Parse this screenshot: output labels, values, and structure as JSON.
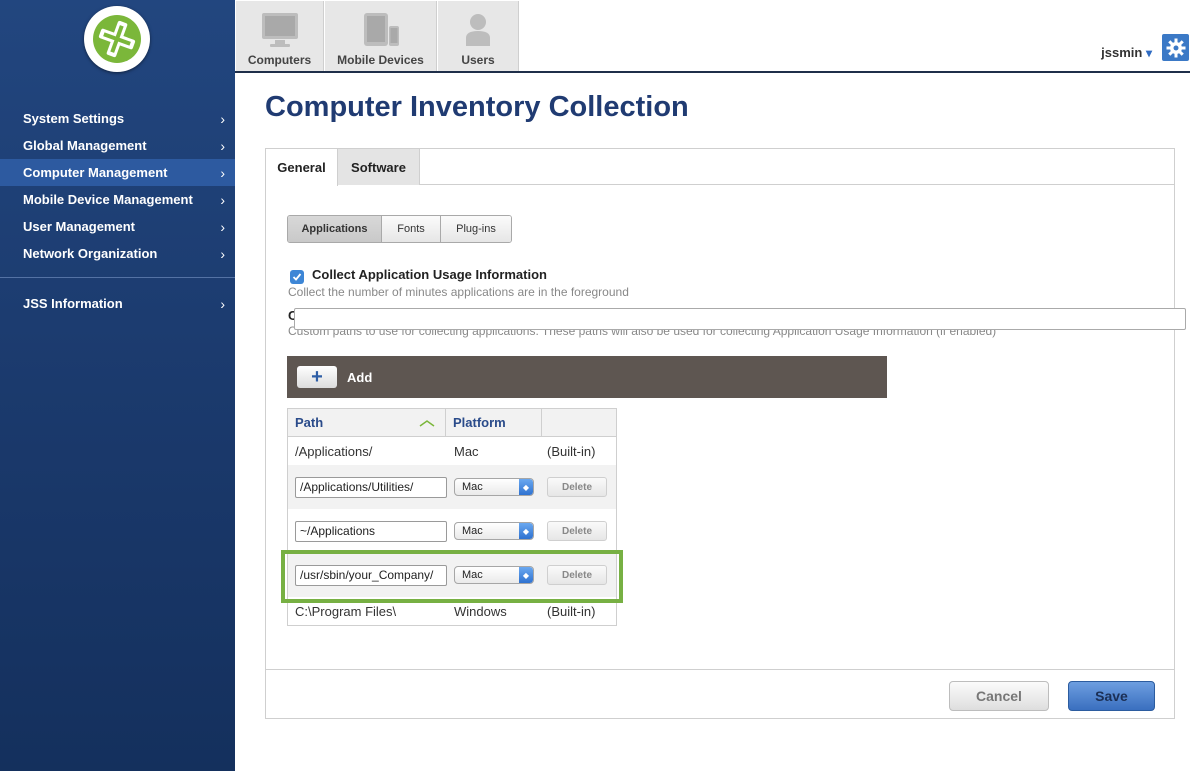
{
  "sidebar": {
    "items": [
      {
        "label": "System Settings",
        "active": false
      },
      {
        "label": "Global Management",
        "active": false
      },
      {
        "label": "Computer Management",
        "active": true
      },
      {
        "label": "Mobile Device Management",
        "active": false
      },
      {
        "label": "User Management",
        "active": false
      },
      {
        "label": "Network Organization",
        "active": false
      }
    ],
    "secondary": [
      {
        "label": "JSS Information"
      }
    ],
    "chevron": "›"
  },
  "topnav": {
    "tabs": [
      {
        "label": "Computers",
        "icon": "monitor-icon"
      },
      {
        "label": "Mobile Devices",
        "icon": "mobile-devices-icon"
      },
      {
        "label": "Users",
        "icon": "user-icon"
      }
    ],
    "username": "jssmin",
    "caret": "▾"
  },
  "page": {
    "title": "Computer Inventory Collection"
  },
  "panel": {
    "tabs": [
      "General",
      "Software"
    ],
    "segments": [
      "Applications",
      "Fonts",
      "Plug-ins"
    ],
    "checkbox_label": "Collect Application Usage Information",
    "checkbox_checked": true,
    "checkbox_help": "Collect the number of minutes applications are in the foreground",
    "custom_paths_label": "C",
    "custom_paths_help": "Custom paths to use for collecting applications. These paths will also be used for collecting Application Usage Information (if enabled)",
    "add_label": "Add",
    "table": {
      "headers": [
        "Path",
        "Platform",
        ""
      ],
      "sort_icon": "sort-up-icon",
      "rows": [
        {
          "type": "static",
          "path": "/Applications/",
          "platform": "Mac",
          "status": "(Built-in)"
        },
        {
          "type": "edit",
          "path": "/Applications/Utilities/",
          "platform": "Mac",
          "action": "Delete"
        },
        {
          "type": "edit",
          "path": "~/Applications",
          "platform": "Mac",
          "action": "Delete"
        },
        {
          "type": "edit",
          "path": "/usr/sbin/your_Company/",
          "platform": "Mac",
          "action": "Delete"
        },
        {
          "type": "static",
          "path": "C:\\Program Files\\",
          "platform": "Windows",
          "status": "(Built-in)"
        }
      ]
    },
    "cancel_label": "Cancel",
    "save_label": "Save"
  },
  "colors": {
    "sidebar": "#1b3a6d",
    "active_nav": "#2d5aa0",
    "title": "#203b72",
    "highlight": "#77b043",
    "add_bar": "#5e5651"
  }
}
